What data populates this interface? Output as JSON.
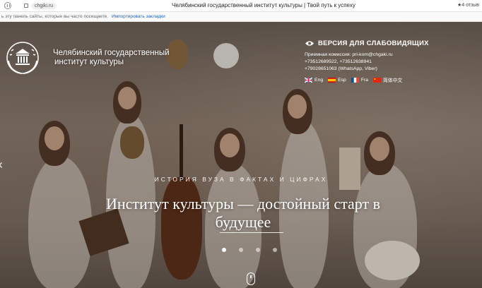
{
  "browser": {
    "url": "chgiki.ru",
    "page_title": "Челябинский государственный институт культуры | Твой путь к успеху",
    "reviews": "★4 отзыв"
  },
  "bookmarks_bar": {
    "text": "ь эту панель сайты, которые вы часто посещаете.",
    "import_link": "Импортировать закладки"
  },
  "header": {
    "university_name_line1": "Челябинский государственный",
    "university_name_line2": "институт культуры",
    "accessibility_label": "ВЕРСИЯ ДЛЯ СЛАБОВИДЯЩИХ",
    "contacts": {
      "admissions": "Приемная комиссия: pri-kom@chgaki.ru",
      "phones": "+73512689522, +73512638941",
      "mobile": "+79028651063 (WhatsApp, Viber)"
    },
    "languages": [
      {
        "label": "Eng",
        "flag_icon": "uk-flag-icon"
      },
      {
        "label": "Esp",
        "flag_icon": "spain-flag-icon"
      },
      {
        "label": "Fra",
        "flag_icon": "france-flag-icon"
      },
      {
        "label": "简体中文",
        "flag_icon": "china-flag-icon"
      }
    ]
  },
  "slider": {
    "kicker": "ИСТОРИЯ ВУЗА В ФАКТАХ И ЦИФРАХ",
    "headline": "Институт культуры — достойный старт в будущее",
    "slides_count": 4,
    "active_slide": 1
  },
  "colors": {
    "accent_link": "#1a66c2",
    "hero_text": "#ffffff"
  }
}
